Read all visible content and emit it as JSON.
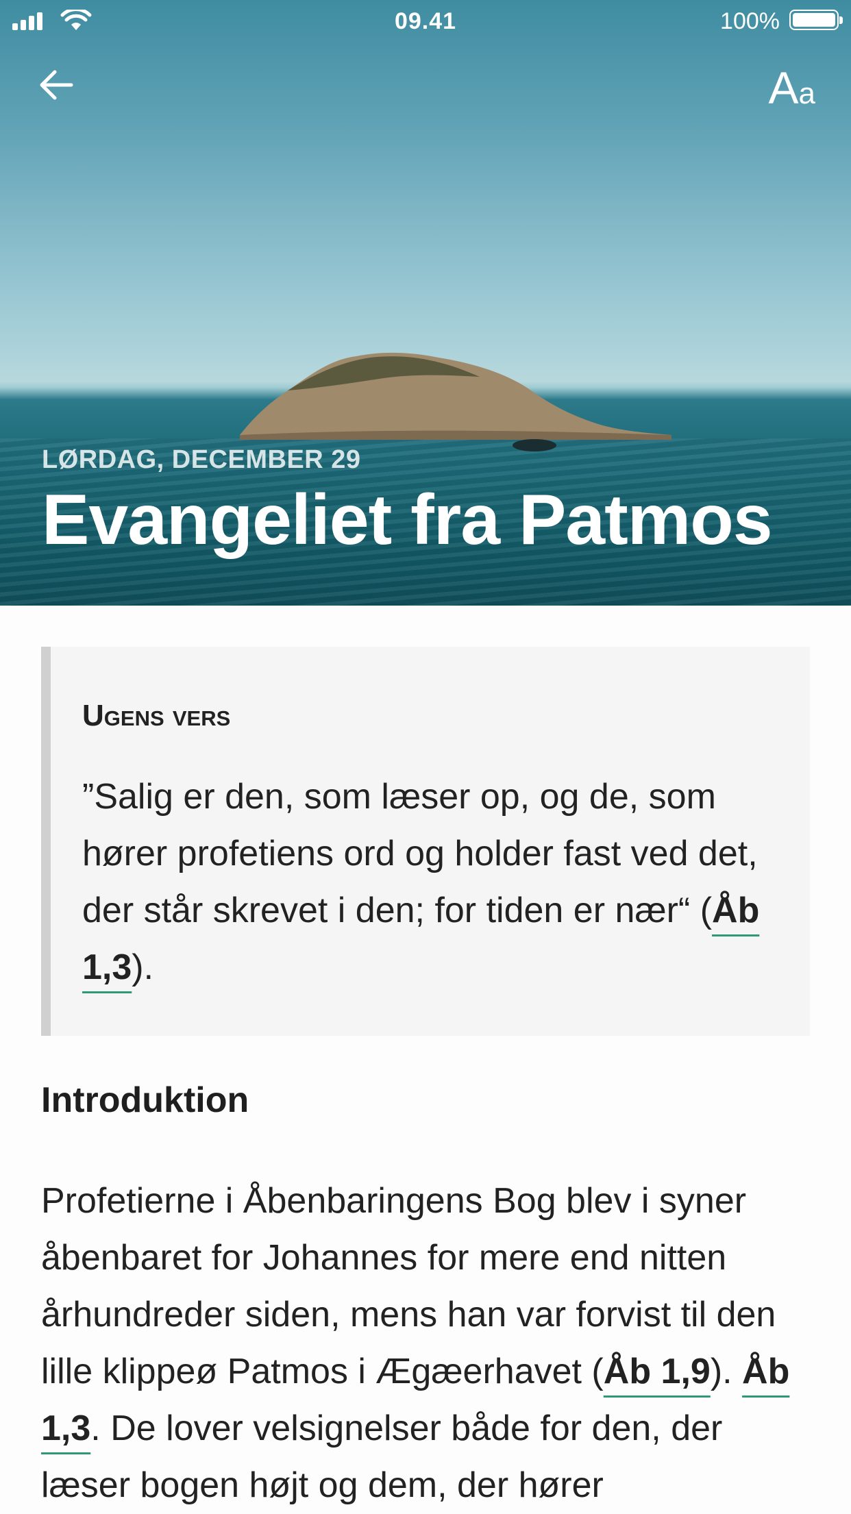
{
  "status_bar": {
    "time": "09.41",
    "battery": "100%"
  },
  "header": {
    "font_button_big": "A",
    "font_button_small": "a"
  },
  "hero": {
    "date": "LØRDAG, DECEMBER 29",
    "title": "Evangeliet fra Patmos"
  },
  "memory_verse": {
    "heading": "Ugens vers",
    "text": "”Salig er den, som læser op, og de, som hører profetiens ord og holder fast ved det, der står skrevet i den; for tiden er nær“ (",
    "ref": "Åb 1,3",
    "after": ")."
  },
  "intro": {
    "heading": "Introduktion",
    "text1": "Profetierne i Åbenbaringens Bog blev i syner åbenbaret for Johannes for mere end nitten århundreder siden, mens han var forvist til den lille klippeø Patmos i Ægæerhavet (",
    "ref1": "Åb 1,9",
    "text2": "). ",
    "ref2": "Åb 1,3",
    "text3": ". De lover velsignelser både for den, der læser bogen højt og dem, der hører"
  },
  "colors": {
    "link_underline": "#2e9a74",
    "sea": "#145d6a",
    "sky": "#8dbfcd"
  },
  "icons": [
    "signal-icon",
    "wifi-icon",
    "battery-icon",
    "back-arrow-icon",
    "font-size-icon"
  ]
}
